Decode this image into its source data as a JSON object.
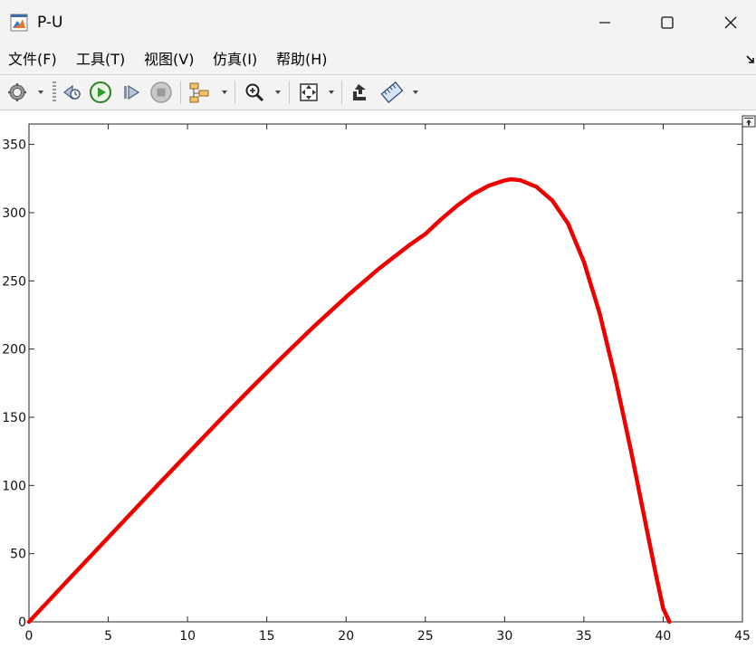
{
  "window": {
    "title": "P-U",
    "icon": "matlab-figure-icon",
    "controls": [
      "minimize-icon",
      "maximize-icon",
      "close-icon"
    ]
  },
  "menu": {
    "items": [
      {
        "label": "文件(F)"
      },
      {
        "label": "工具(T)"
      },
      {
        "label": "视图(V)"
      },
      {
        "label": "仿真(I)"
      },
      {
        "label": "帮助(H)"
      }
    ]
  },
  "toolbar": {
    "icons": [
      "settings-gear-icon",
      "step-back-icon",
      "run-icon",
      "step-forward-icon",
      "stop-icon",
      "signal-hierarchy-icon",
      "zoom-icon",
      "fit-to-view-icon",
      "restore-view-icon",
      "measurements-ruler-icon"
    ]
  },
  "colors": {
    "curve": "#ee0000",
    "axes_background": "#ffffff",
    "chrome": "#f3f3f3"
  },
  "chart_data": {
    "type": "line",
    "title": "",
    "xlabel": "",
    "ylabel": "",
    "xlim": [
      0,
      45
    ],
    "ylim": [
      0,
      365
    ],
    "x_ticks": [
      0,
      5,
      10,
      15,
      20,
      25,
      30,
      35,
      40,
      45
    ],
    "y_ticks": [
      0,
      50,
      100,
      150,
      200,
      250,
      300,
      350
    ],
    "grid": false,
    "legend": "none",
    "series": [
      {
        "x": [
          0,
          2,
          4,
          6,
          8,
          10,
          12,
          14,
          16,
          18,
          20,
          22,
          24,
          25,
          26,
          27,
          28,
          29,
          30,
          30.4,
          31,
          32,
          33,
          34,
          35,
          36,
          37,
          38,
          39,
          39.5,
          40,
          40.4
        ],
        "y": [
          0,
          24.8,
          49.5,
          74.2,
          98.8,
          123.2,
          147.4,
          171.2,
          194.4,
          216.8,
          238.2,
          258.2,
          276.3,
          284.4,
          295.2,
          305.1,
          313.5,
          319.8,
          323.6,
          324.5,
          323.7,
          319.0,
          309.0,
          292.0,
          264.0,
          226.0,
          178.0,
          124.0,
          66.0,
          37.0,
          10.0,
          0
        ]
      }
    ]
  }
}
